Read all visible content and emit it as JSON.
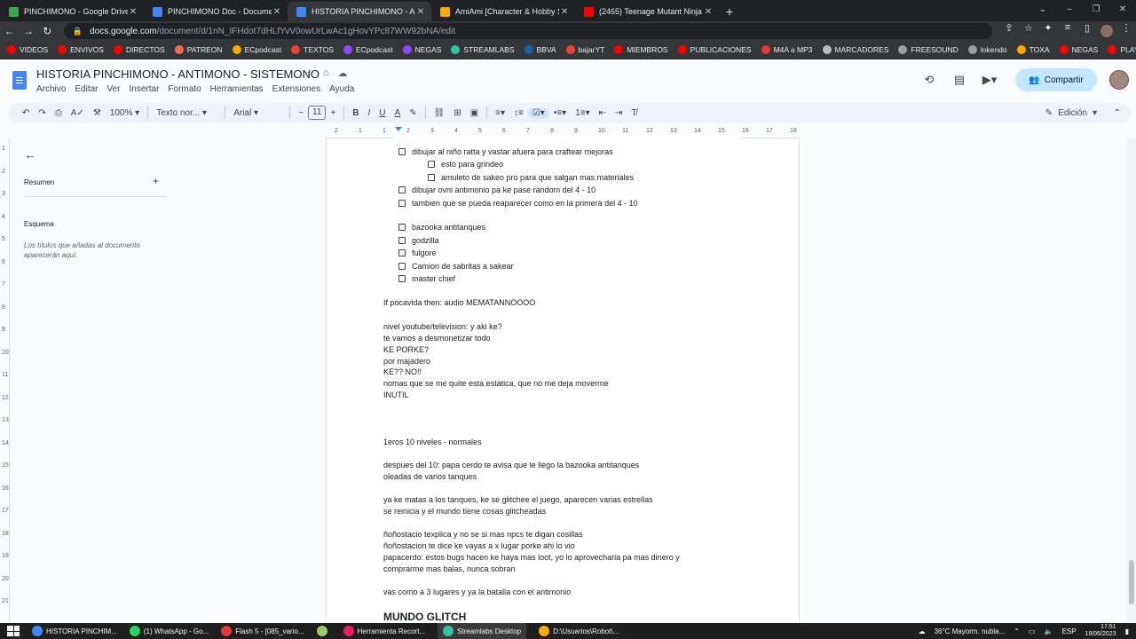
{
  "browser": {
    "tabs": [
      {
        "title": "PINCHIMONO - Google Drive",
        "color": "#34a853",
        "active": false
      },
      {
        "title": "PINCHIMONO Doc - Documento",
        "color": "#4285f4",
        "active": false
      },
      {
        "title": "HISTORIA PINCHIMONO - ANTIM",
        "color": "#4285f4",
        "active": true
      },
      {
        "title": "AmiAmi [Character & Hobby Sho",
        "color": "#f9ab00",
        "active": false
      },
      {
        "title": "(2465) Teenage Mutant Ninja",
        "color": "#ff0000",
        "active": false
      }
    ],
    "url_domain": "docs.google.com",
    "url_path": "/document/d/1nN_IFHdot7dHLfYvV0owUrLwAc1gHovYPc87WW92bNA/edit",
    "bookmarks": [
      {
        "label": "VIDEOS",
        "color": "#ff0000"
      },
      {
        "label": "ENVIVOS",
        "color": "#ff0000"
      },
      {
        "label": "DIRECTOS",
        "color": "#ff0000"
      },
      {
        "label": "PATREON",
        "color": "#f96854"
      },
      {
        "label": "ECpodcast",
        "color": "#f9ab00"
      },
      {
        "label": "TEXTOS",
        "color": "#ea4335"
      },
      {
        "label": "ECpodcast",
        "color": "#9146ff"
      },
      {
        "label": "NEGAS",
        "color": "#9146ff"
      },
      {
        "label": "STREAMLABS",
        "color": "#31c3a2"
      },
      {
        "label": "BBVA",
        "color": "#1464a5"
      },
      {
        "label": "bajarYT",
        "color": "#ea4335"
      },
      {
        "label": "MIEMBROS",
        "color": "#ff0000"
      },
      {
        "label": "PUBLICACIONES",
        "color": "#ff0000"
      },
      {
        "label": "M4A a MP3",
        "color": "#e53935"
      },
      {
        "label": "MARCADORES",
        "color": "#bdbdbd"
      },
      {
        "label": "FREESOUND",
        "color": "#9e9e9e"
      },
      {
        "label": "lokendo",
        "color": "#9e9e9e"
      },
      {
        "label": "TOXA",
        "color": "#f9ab00"
      },
      {
        "label": "NEGAS",
        "color": "#ff0000"
      },
      {
        "label": "PLAYLISTS",
        "color": "#ff0000"
      }
    ]
  },
  "doc": {
    "title": "HISTORIA PINCHIMONO - ANTIMONO - SISTEMONO",
    "menu": [
      "Archivo",
      "Editar",
      "Ver",
      "Insertar",
      "Formato",
      "Herramientas",
      "Extensiones",
      "Ayuda"
    ],
    "share_label": "Compartir",
    "toolbar": {
      "zoom": "100%",
      "style": "Texto nor...",
      "font": "Arial",
      "size": "11",
      "mode": "Edición"
    },
    "ruler_ticks": [
      "2",
      "1",
      "1",
      "2",
      "3",
      "4",
      "5",
      "6",
      "7",
      "8",
      "9",
      "10",
      "11",
      "12",
      "13",
      "14",
      "15",
      "16",
      "17",
      "18"
    ],
    "vruler_ticks": [
      "1",
      "2",
      "3",
      "4",
      "5",
      "6",
      "7",
      "8",
      "9",
      "10",
      "11",
      "12",
      "13",
      "14",
      "15",
      "16",
      "17",
      "18",
      "19",
      "20",
      "21"
    ],
    "sidebar": {
      "summary_label": "Resumen",
      "outline_label": "Esquema",
      "outline_hint": "Los títulos que añadas al documento aparecerán aquí."
    },
    "lines": {
      "c1": "dibujar al niño ratta y vastar afuera para craftear mejoras",
      "c2": "esto para grindeo",
      "c3": "amuleto de sakeo pro para que salgan mas materiales",
      "c4": "dibujar ovni antimonio pa ke pase random del 4 - 10",
      "c5": "tambien que se pueda reaparecer como en la primera del 4 - 10",
      "c6": "bazooka antitanques",
      "c7": "godzilla",
      "c8": "fulgore",
      "c9": "Camion de sabritas a sakear",
      "c10": "master chief",
      "p1": "If pocavida then: audio MEMATANNOOOO",
      "p2": "nivel youtube/television: y aki ke?",
      "p3": "te vamos a desmonetizar todo",
      "p4": "KE PORKE?",
      "p5": "por majadero",
      "p6": "KE?? NO!!",
      "p7": "nomas que se me quite esta estática, que no me deja moverme",
      "p8": "INUTIL",
      "p9": "1eros 10 niveles - normales",
      "p10": "despues del 10: papa cerdo te avisa que le llego la bazooka antitanques",
      "p11": "oleadas de varios tanques",
      "p12": "ya ke matas a los tanques, ke se glitchee el juego, aparecen varias estrellas",
      "p13": "se reinicia y el mundo tiene cosas glitcheadas",
      "p14": "ñoñostacio texplica y no se si mas npcs te digan cosillas",
      "p15": "ñoñostacion te dice ke vayas a x lugar porke ahi lo vio",
      "p16": "papacerdo: estos bugs hacen ke haya mas loot, yo lo aprovecharia pa mas dinero y",
      "p17": "comprarme mas balas, nunca sobran",
      "p18": "vas como a 3 lugares y ya la batalla con el antimonio",
      "h1": "MUNDO GLITCH"
    }
  },
  "taskbar": {
    "items": [
      {
        "label": "HISTORIA PINCHIM...",
        "color": "#4285f4",
        "active": false
      },
      {
        "label": "(1) WhatsApp - Go...",
        "color": "#25d366",
        "active": false
      },
      {
        "label": "Flash 5 - [085_vario...",
        "color": "#e53935",
        "active": false
      },
      {
        "label": "",
        "color": "#9ccc65",
        "active": false
      },
      {
        "label": "Herramienta Recort...",
        "color": "#e91e63",
        "active": false
      },
      {
        "label": "Streamlabs Desktop",
        "color": "#31c3a2",
        "active": true
      },
      {
        "label": "D:\\Usuarios\\Robot\\...",
        "color": "#f9ab00",
        "active": false
      }
    ],
    "weather": "36°C  Mayorm. nubla...",
    "lang": "ESP",
    "time": "17:51",
    "date": "18/06/2023"
  }
}
